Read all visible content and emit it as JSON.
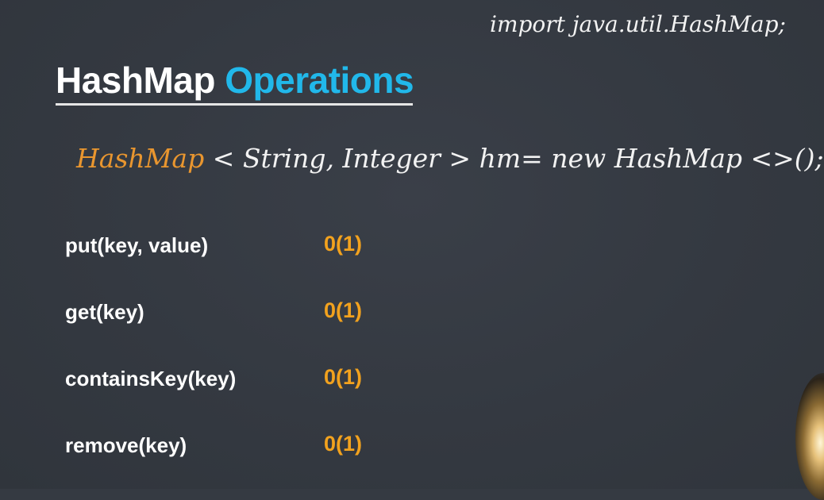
{
  "slide": {
    "title_part1": "HashMap",
    "title_part2": "Operations",
    "title_colors": {
      "part1": "#ffffff",
      "part2": "#21b8ea"
    },
    "background_color": "#353a42"
  },
  "handwriting": {
    "import_statement": "import java.util.HashMap;",
    "declaration_type": "HashMap",
    "declaration_rest": "< String, Integer > hm= new HashMap <>();",
    "colors": {
      "type": "#e9962f",
      "text": "#f2f2f2"
    }
  },
  "operations": [
    {
      "name": "put(key, value)",
      "complexity": "0(1)"
    },
    {
      "name": "get(key)",
      "complexity": "0(1)"
    },
    {
      "name": "containsKey(key)",
      "complexity": "0(1)"
    },
    {
      "name": "remove(key)",
      "complexity": "0(1)"
    }
  ],
  "accent_colors": {
    "complexity": "#f2a21e"
  },
  "decorations": {
    "corner_light_icon": "lamp-glow-icon"
  }
}
